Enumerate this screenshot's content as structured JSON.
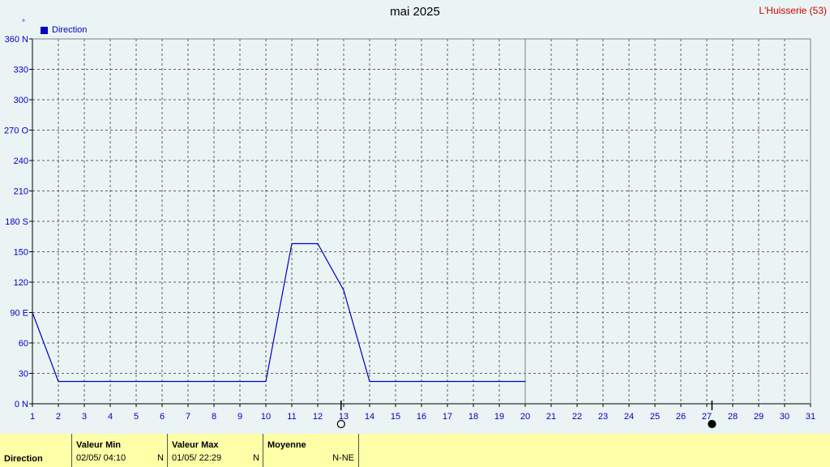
{
  "title": "mai 2025",
  "station": "L'Huisserie (53)",
  "unit_symbol": "°",
  "legend": {
    "label": "Direction",
    "color": "#0000c0"
  },
  "chart_data": {
    "type": "line",
    "title": "mai 2025",
    "xlabel": "",
    "ylabel": "°",
    "xlim": [
      1,
      31
    ],
    "ylim": [
      0,
      360
    ],
    "x_ticks": [
      1,
      2,
      3,
      4,
      5,
      6,
      7,
      8,
      9,
      10,
      11,
      12,
      13,
      14,
      15,
      16,
      17,
      18,
      19,
      20,
      21,
      22,
      23,
      24,
      25,
      26,
      27,
      28,
      29,
      30,
      31
    ],
    "y_ticks": [
      {
        "value": 0,
        "label": "0  N"
      },
      {
        "value": 30,
        "label": "30"
      },
      {
        "value": 60,
        "label": "60"
      },
      {
        "value": 90,
        "label": "90  E"
      },
      {
        "value": 120,
        "label": "120"
      },
      {
        "value": 150,
        "label": "150"
      },
      {
        "value": 180,
        "label": "180 S"
      },
      {
        "value": 210,
        "label": "210"
      },
      {
        "value": 240,
        "label": "240"
      },
      {
        "value": 270,
        "label": "270 O"
      },
      {
        "value": 300,
        "label": "300"
      },
      {
        "value": 330,
        "label": "330"
      },
      {
        "value": 360,
        "label": "360 N"
      }
    ],
    "grid": true,
    "current_day_marker": 20,
    "moon_phases": [
      {
        "day": 12.9,
        "phase": "full"
      },
      {
        "day": 27.2,
        "phase": "new"
      }
    ],
    "series": [
      {
        "name": "Direction",
        "color": "#0000c0",
        "x": [
          1,
          2,
          3,
          4,
          5,
          6,
          7,
          8,
          9,
          10,
          11,
          12,
          13,
          14,
          15,
          16,
          17,
          18,
          19,
          20
        ],
        "values": [
          90,
          22,
          22,
          22,
          22,
          22,
          22,
          22,
          22,
          22,
          158,
          158,
          112,
          22,
          22,
          22,
          22,
          22,
          22,
          22
        ]
      }
    ]
  },
  "table": {
    "row_label": "Direction",
    "min": {
      "header": "Valeur Min",
      "date": "02/05/  04:10",
      "card": "N"
    },
    "max": {
      "header": "Valeur Max",
      "date": "01/05/  22:29",
      "card": "N"
    },
    "avg": {
      "header": "Moyenne",
      "value": "N-NE"
    }
  }
}
